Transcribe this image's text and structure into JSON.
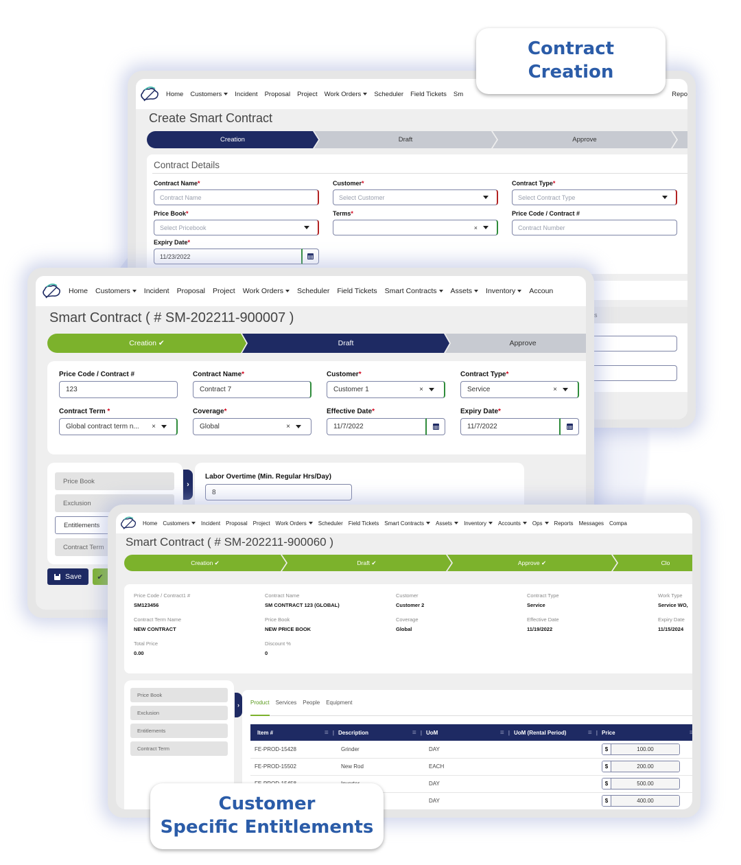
{
  "callouts": {
    "top": [
      "Contract",
      "Creation"
    ],
    "bottom": [
      "Customer",
      "Specific Entitlements"
    ]
  },
  "window1": {
    "nav": [
      "Home",
      "Customers",
      "Incident",
      "Proposal",
      "Project",
      "Work Orders",
      "Scheduler",
      "Field Tickets",
      "Sm",
      "Repo"
    ],
    "title": "Create Smart Contract",
    "steps": [
      "Creation",
      "Draft",
      "Approve"
    ],
    "section_title": "Contract Details",
    "fields": {
      "contract_name": {
        "label": "Contract Name",
        "placeholder": "Contract Name"
      },
      "customer": {
        "label": "Customer",
        "placeholder": "Select Customer"
      },
      "contract_type": {
        "label": "Contract Type",
        "placeholder": "Select Contract Type"
      },
      "price_book": {
        "label": "Price Book",
        "placeholder": "Select Pricebook"
      },
      "terms": {
        "label": "Terms",
        "value": ""
      },
      "price_code": {
        "label": "Price Code / Contract #",
        "placeholder": "Contract Number"
      },
      "expiry_date": {
        "label": "Expiry Date",
        "value": "11/23/2022"
      }
    },
    "partial_label": "ls"
  },
  "window2": {
    "nav": [
      "Home",
      "Customers",
      "Incident",
      "Proposal",
      "Project",
      "Work Orders",
      "Scheduler",
      "Field Tickets",
      "Smart Contracts",
      "Assets",
      "Inventory",
      "Accoun"
    ],
    "title": "Smart Contract ( # SM-202211-900007 )",
    "steps": [
      "Creation ✔",
      "Draft",
      "Approve"
    ],
    "fields": {
      "price_code": {
        "label": "Price Code / Contract #",
        "value": "123"
      },
      "contract_name": {
        "label": "Contract Name",
        "value": "Contract 7"
      },
      "customer": {
        "label": "Customer",
        "value": "Customer 1"
      },
      "contract_type": {
        "label": "Contract Type",
        "value": "Service"
      },
      "contract_term": {
        "label": "Contract Term",
        "value": "Global contract term n..."
      },
      "coverage": {
        "label": "Coverage",
        "value": "Global"
      },
      "effective_date": {
        "label": "Effective Date",
        "value": "11/7/2022"
      },
      "expiry_date": {
        "label": "Expiry Date",
        "value": "11/7/2022"
      }
    },
    "side_menu": [
      "Price Book",
      "Exclusion",
      "Entitlements",
      "Contract Term"
    ],
    "labor_overtime": {
      "label": "Labor Overtime (Min. Regular Hrs/Day)",
      "value": "8"
    },
    "save_label": "Save",
    "confirm_icon": "✔"
  },
  "window3": {
    "nav": [
      "Home",
      "Customers",
      "Incident",
      "Proposal",
      "Project",
      "Work Orders",
      "Scheduler",
      "Field Tickets",
      "Smart Contracts",
      "Assets",
      "Inventory",
      "Accounts",
      "Ops",
      "Reports",
      "Messages",
      "Compa"
    ],
    "title": "Smart Contract ( # SM-202211-900060 )",
    "steps": [
      "Creation ✔",
      "Draft ✔",
      "Approve ✔",
      "Clo"
    ],
    "details": [
      {
        "label": "Price Code / Contract1 #",
        "value": "SM123456"
      },
      {
        "label": "Contract Name",
        "value": "SM CONTRACT 123 (GLOBAL)"
      },
      {
        "label": "Customer",
        "value": "Customer 2"
      },
      {
        "label": "Contract Type",
        "value": "Service"
      },
      {
        "label": "Work Type",
        "value": "Service WO,"
      },
      {
        "label": "Contract Term Name",
        "value": "NEW CONTRACT"
      },
      {
        "label": "Price Book",
        "value": "NEW PRICE BOOK"
      },
      {
        "label": "Coverage",
        "value": "Global"
      },
      {
        "label": "Effective Date",
        "value": "11/19/2022"
      },
      {
        "label": "Expiry Date",
        "value": "11/15/2024"
      },
      {
        "label": "Total Price",
        "value": "0.00"
      },
      {
        "label": "Discount %",
        "value": "0"
      }
    ],
    "side_menu": [
      "Price Book",
      "Exclusion",
      "Entitlements",
      "Contract Term"
    ],
    "tabs": [
      "Product",
      "Services",
      "People",
      "Equipment"
    ],
    "active_tab": "Product",
    "table": {
      "columns": [
        "Item #",
        "Description",
        "UoM",
        "UoM (Rental Period)",
        "Price"
      ],
      "currency": "$",
      "rows": [
        {
          "item": "FE-PROD-15428",
          "description": "Grinder",
          "uom": "DAY",
          "rental": "",
          "price": "100.00"
        },
        {
          "item": "FE-PROD-15502",
          "description": "New Rod",
          "uom": "EACH",
          "rental": "",
          "price": "200.00"
        },
        {
          "item": "FE-PROD-15458",
          "description": "Inverter",
          "uom": "DAY",
          "rental": "",
          "price": "500.00"
        },
        {
          "item": "",
          "description": "",
          "uom": "DAY",
          "rental": "",
          "price": "400.00"
        }
      ]
    }
  },
  "colors": {
    "navy": "#1e2a63",
    "green": "#7cb22c",
    "callout_blue": "#2b5ca8",
    "required_red": "#d0021b"
  }
}
